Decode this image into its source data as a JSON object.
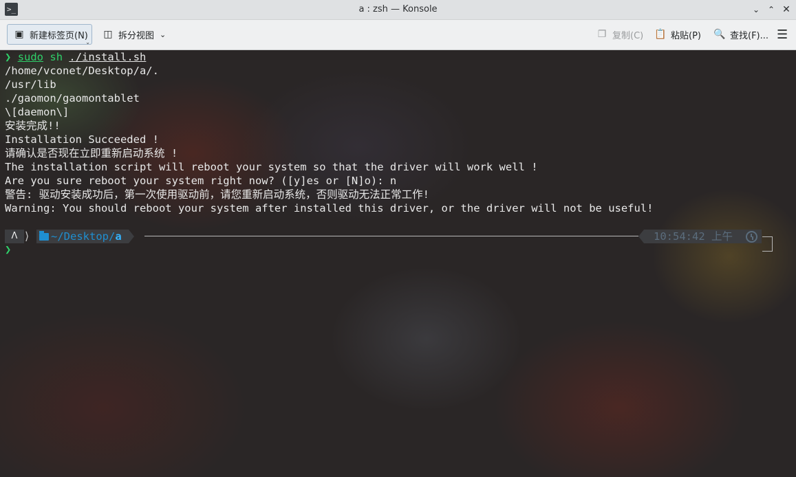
{
  "window": {
    "title": "a : zsh — Konsole",
    "app_icon": "terminal-icon",
    "controls": [
      "chevron-down-icon",
      "chevron-up-icon",
      "close-icon"
    ]
  },
  "toolbar": {
    "new_tab": "新建标签页(N)",
    "split_view": "拆分视图",
    "copy": "复制(C)",
    "paste": "粘贴(P)",
    "find": "查找(F)...",
    "menu": "hamburger-menu-icon"
  },
  "terminal": {
    "prompt_symbol": "❯",
    "command": {
      "cmd": "sudo",
      "shell": "sh",
      "arg": "./install.sh"
    },
    "output": [
      "/home/vconet/Desktop/a/.",
      "/usr/lib",
      "./gaomon/gaomontablet",
      "\\[daemon\\]",
      "安装完成!!",
      "Installation Succeeded !",
      "请确认是否现在立即重新启动系统 !",
      "The installation script will reboot your system so that the driver will work well !",
      "Are you sure reboot your system right now? ([y]es or [N]o): n",
      "警告: 驱动安装成功后，第一次使用驱动前，请您重新启动系统，否则驱动无法正常工作!",
      "Warning: You should reboot your system after installed this driver, or the driver will not be useful!"
    ],
    "prompt_path_prefix": "~/Desktop/",
    "prompt_path_last": "a",
    "prompt_time": "10:54:42 上午"
  },
  "colors": {
    "prompt_green": "#2fd06a",
    "path_blue": "#1f8fd0",
    "segment_bg": "#3c3d40",
    "time_fg": "#5b6d7d"
  }
}
